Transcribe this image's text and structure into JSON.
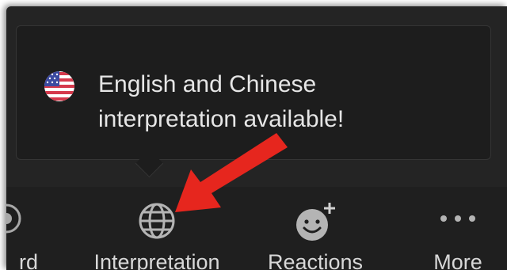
{
  "tooltip": {
    "flag_icon": "us-flag-icon",
    "line1": "English and Chinese",
    "line2": "interpretation available!"
  },
  "toolbar": {
    "items": [
      {
        "label": "rd",
        "icon": "record-icon"
      },
      {
        "label": "Interpretation",
        "icon": "globe-icon"
      },
      {
        "label": "Reactions",
        "icon": "emoji-add-icon"
      },
      {
        "label": "More",
        "icon": "more-dots-icon"
      }
    ]
  },
  "colors": {
    "background": "#242424",
    "toolbar": "#1f1f1f",
    "text": "#e6e6e6",
    "arrow": "#e6261e"
  }
}
